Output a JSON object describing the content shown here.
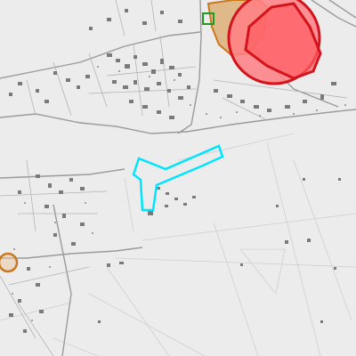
{
  "map": {
    "basemap": "light-grey",
    "colors": {
      "background": "#ececec",
      "roads": "#9a9a9a",
      "minor_roads": "#b6b6b6",
      "buildings": "#6d6d6d",
      "field_lines": "#c9c9c9",
      "highlight_cyan": "#00e5ff",
      "zone_red_fill": "#ff6f73",
      "zone_red_stroke": "#d4141c",
      "zone_orange": "#c9781b",
      "zone_green": "#1f9b22"
    },
    "overlays": [
      {
        "name": "cyan-outlined-parcel",
        "color": "#00e5ff",
        "style": "outline"
      },
      {
        "name": "red-filled-zone",
        "color": "#ff6f73",
        "style": "filled"
      },
      {
        "name": "orange-zone-north",
        "color": "#c9781b",
        "style": "filled"
      },
      {
        "name": "orange-ring-west",
        "color": "#c9781b",
        "style": "outline"
      },
      {
        "name": "green-square",
        "color": "#1f9b22",
        "style": "outline"
      }
    ]
  }
}
